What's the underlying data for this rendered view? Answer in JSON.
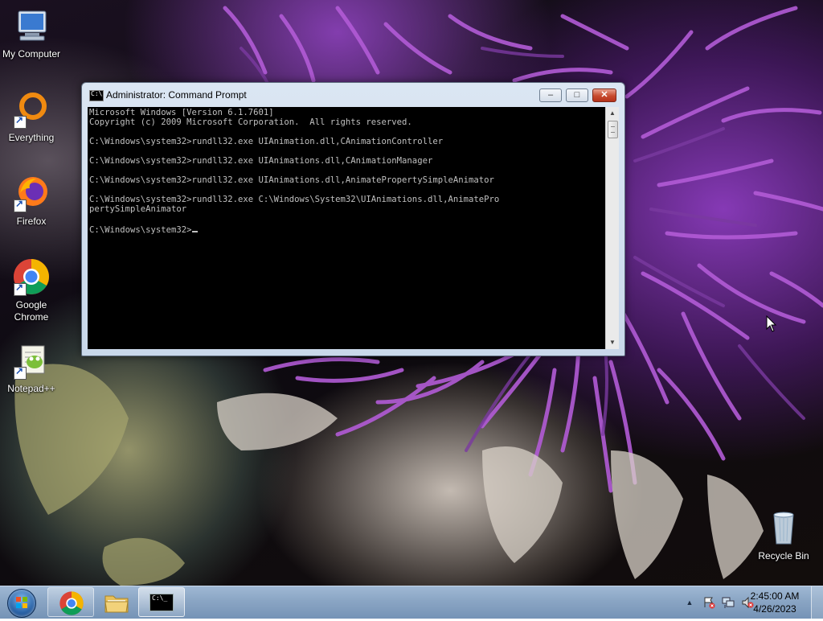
{
  "desktop": {
    "icons": [
      {
        "label": "My Computer",
        "icon": "computer-icon"
      },
      {
        "label": "Everything",
        "icon": "everything-search-icon"
      },
      {
        "label": "Firefox",
        "icon": "firefox-icon"
      },
      {
        "label": "Google Chrome",
        "icon": "chrome-icon"
      },
      {
        "label": "Notepad++",
        "icon": "notepadpp-icon"
      },
      {
        "label": "Recycle Bin",
        "icon": "recycle-bin-icon"
      }
    ]
  },
  "window": {
    "title": "Administrator: Command Prompt",
    "minimize_symbol": "–",
    "maximize_symbol": "□",
    "close_symbol": "✕",
    "console_text": "Microsoft Windows [Version 6.1.7601]\nCopyright (c) 2009 Microsoft Corporation.  All rights reserved.\n\nC:\\Windows\\system32>rundll32.exe UIAnimation.dll,CAnimationController\n\nC:\\Windows\\system32>rundll32.exe UIAnimations.dll,CAnimationManager\n\nC:\\Windows\\system32>rundll32.exe UIAnimations.dll,AnimatePropertySimpleAnimator\n\nC:\\Windows\\system32>rundll32.exe C:\\Windows\\System32\\UIAnimations.dll,AnimatePro\npertySimpleAnimator\n\nC:\\Windows\\system32>"
  },
  "taskbar": {
    "items": [
      {
        "name": "start-button",
        "icon": "windows-logo-icon"
      },
      {
        "name": "chrome",
        "icon": "chrome-icon"
      },
      {
        "name": "explorer",
        "icon": "folder-icon"
      },
      {
        "name": "command-prompt",
        "icon": "cmd-icon"
      }
    ],
    "tray": {
      "show_hidden_symbol": "▲",
      "icons": [
        "action-center-icon",
        "network-icon",
        "volume-muted-icon"
      ]
    },
    "clock": {
      "time": "2:45:00 AM",
      "date": "4/26/2023"
    }
  },
  "colors": {
    "console_bg": "#000000",
    "console_fg": "#c0c0c0",
    "close_button": "#c74a2e",
    "taskbar": "#8aa5c4"
  }
}
